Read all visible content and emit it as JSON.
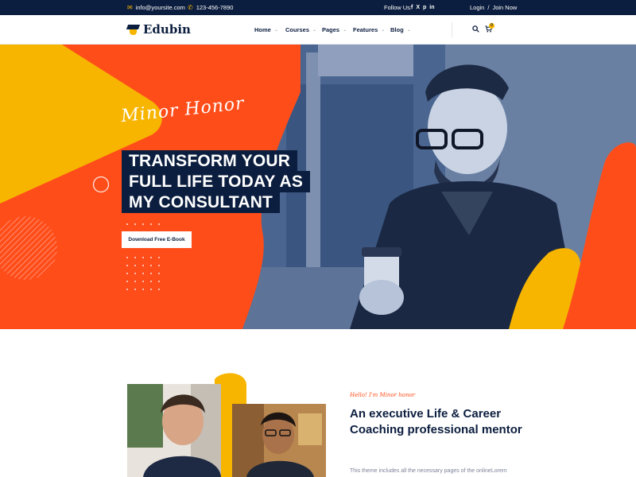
{
  "topbar": {
    "email": "info@yoursite.com",
    "phone": "123-456-7890",
    "follow_label": "Follow Us:",
    "social": [
      "f",
      "X",
      "p",
      "in"
    ],
    "login": "Login",
    "separator": "/",
    "join": "Join Now"
  },
  "header": {
    "logo_text": "Edubin",
    "nav": [
      "Home",
      "Courses",
      "Pages",
      "Features",
      "Blog"
    ],
    "cart_count": "0"
  },
  "hero": {
    "signature": "Minor Honor",
    "headline": [
      "TRANSFORM YOUR",
      "FULL LIFE TODAY AS",
      "MY CONSULTANT"
    ],
    "cta": "Download Free E-Book"
  },
  "about": {
    "signature": "Hello! I'm Minor honor",
    "title": "An executive Life & Career Coaching professional mentor",
    "text": "This theme includes all the necessary pages of the onlineLorem"
  },
  "colors": {
    "navy": "#0c1e3f",
    "orange": "#ff4d1a",
    "yellow": "#f7b500",
    "photo_tint": "#3f5f8f"
  }
}
